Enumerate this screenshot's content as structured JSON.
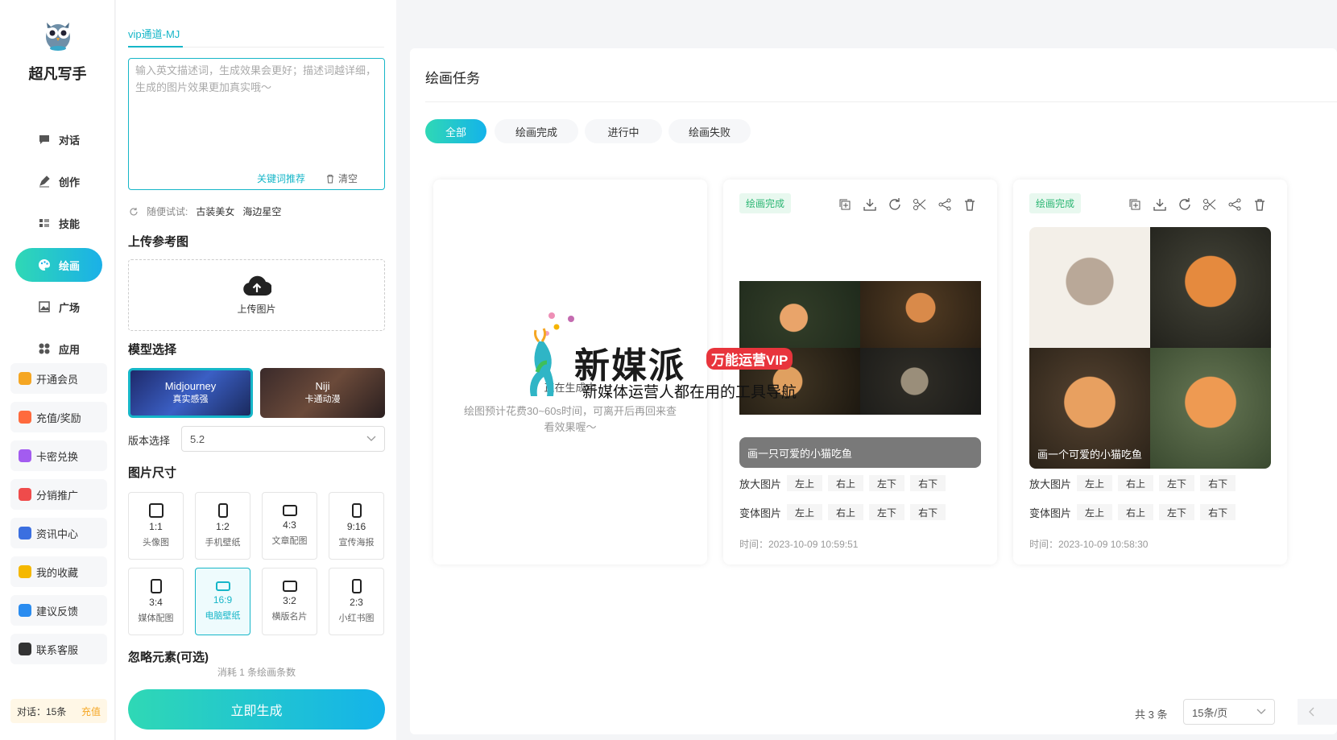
{
  "nav": {
    "brand": "超凡写手",
    "items": [
      {
        "label": "对话",
        "icon": "chat-icon"
      },
      {
        "label": "创作",
        "icon": "pen-icon"
      },
      {
        "label": "技能",
        "icon": "list-icon"
      },
      {
        "label": "绘画",
        "icon": "palette-icon"
      },
      {
        "label": "广场",
        "icon": "image-icon"
      },
      {
        "label": "应用",
        "icon": "apps-icon"
      }
    ],
    "side_buttons": [
      {
        "label": "开通会员",
        "color": "#f5a623"
      },
      {
        "label": "充值/奖励",
        "color": "#ff6a3d"
      },
      {
        "label": "卡密兑换",
        "color": "#a35cf0"
      },
      {
        "label": "分销推广",
        "color": "#ef4b4b"
      },
      {
        "label": "资讯中心",
        "color": "#3b6fe0"
      },
      {
        "label": "我的收藏",
        "color": "#f5b800"
      },
      {
        "label": "建议反馈",
        "color": "#2a8cf0"
      },
      {
        "label": "联系客服",
        "color": "#333333"
      }
    ],
    "quota_label": "对话：15条",
    "quota_link": "充值"
  },
  "config": {
    "tab": "vip通道-MJ",
    "prompt_placeholder": "输入英文描述词，生成效果会更好；描述词越详细，生成的图片效果更加真实哦～",
    "keyword_btn": "关键词推荐",
    "clear_btn": "清空",
    "try_label": "随便试试:",
    "try_items": [
      "古装美女",
      "海边星空"
    ],
    "upload_title": "上传参考图",
    "upload_label": "上传图片",
    "model_title": "模型选择",
    "models": [
      {
        "name": "Midjourney",
        "sub": "真实感强"
      },
      {
        "name": "Niji",
        "sub": "卡通动漫"
      }
    ],
    "version_label": "版本选择",
    "version_value": "5.2",
    "size_title": "图片尺寸",
    "sizes": [
      {
        "ratio": "1:1",
        "name": "头像图"
      },
      {
        "ratio": "1:2",
        "name": "手机壁纸"
      },
      {
        "ratio": "4:3",
        "name": "文章配图"
      },
      {
        "ratio": "9:16",
        "name": "宣传海报"
      },
      {
        "ratio": "3:4",
        "name": "媒体配图"
      },
      {
        "ratio": "16:9",
        "name": "电脑壁纸"
      },
      {
        "ratio": "3:2",
        "name": "横版名片"
      },
      {
        "ratio": "2:3",
        "name": "小红书图"
      }
    ],
    "ignore_title": "忽略元素(可选)",
    "cost_text": "消耗 1 条绘画条数",
    "generate_btn": "立即生成"
  },
  "main": {
    "title": "绘画任务",
    "filters": [
      "全部",
      "绘画完成",
      "进行中",
      "绘画失败"
    ],
    "pending_title": "正在生成中",
    "pending_text": "绘图预计花费30~60s时间，可离开后再回来查看效果喔～",
    "cards": [
      {
        "status": "绘画完成",
        "caption": "画一只可爱的小猫吃鱼",
        "time": "时间：2023-10-09 10:59:51"
      },
      {
        "status": "绘画完成",
        "caption": "画一个可爱的小猫吃鱼",
        "time": "时间：2023-10-09 10:58:30"
      }
    ],
    "upscale_label": "放大图片",
    "variation_label": "变体图片",
    "quadrants": [
      "左上",
      "右上",
      "左下",
      "右下"
    ],
    "pagination_total": "共 3 条",
    "page_size": "15条/页"
  },
  "watermark": {
    "title": "新媒派",
    "badge": "万能运营VIP",
    "subtitle": "新媒体运营人都在用的工具导航"
  }
}
